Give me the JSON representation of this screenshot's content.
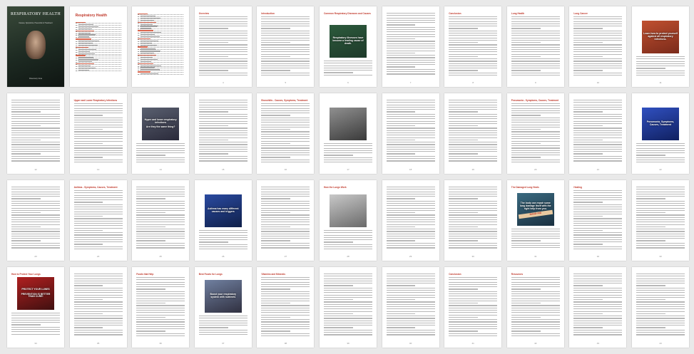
{
  "document": {
    "title": "RESPIRATORY HEALTH",
    "subtitle": "Causes, Symptoms, Prevention & Treatment",
    "author": "Rosemary Gina",
    "toc_title": "Respiratory Health"
  },
  "image_captions": {
    "p14": "Respiratory illnesses have become a leading cause of death.",
    "p18": "Learn how to protect yourself against all respiratory infections.",
    "p21": "Hyper and lower respiratory infections",
    "p21b": "Are they the same thing?",
    "p27": "Pneumonia, Symptoms, Causes, Treatment",
    "p33": "Asthma has many different causes and triggers",
    "p37": "The body can repair some lung damage itself with the right help from you.",
    "p37_label": "BAND-AID",
    "p41": "PROTECT YOUR LUNES",
    "p41b": "PREVENTION IS BETTER THAN CURE!",
    "p45": "Boost your respiratory system with nutrients"
  },
  "headings": [
    "",
    "",
    "",
    "Overview",
    "Introduction",
    "Common Respiratory Diseases and Causes",
    "",
    "Conclusion",
    "Lung Health",
    "Lung Cancer",
    "",
    "",
    "Upper and Lower Respiratory Infections",
    "",
    "",
    "Bronchitis - Causes, Symptoms, Treatment",
    "",
    "",
    "",
    "Pneumonia - Symptoms, Causes, Treatment",
    "",
    "",
    "",
    "Asthma - Symptoms, Causes, Treatment",
    "",
    "",
    "",
    "How the Lungs Work",
    "",
    "",
    "The Damaged Lung Heals",
    "Healing",
    "",
    "How to Protect Your Lungs",
    "",
    "Foods that Help",
    "Best Foods for Lungs",
    "Vitamins and Minerals",
    "",
    "",
    "Conclusion",
    "Resources"
  ],
  "page_numbers": [
    "",
    "2",
    "3",
    "4",
    "5",
    "6",
    "7",
    "8",
    "9",
    "10",
    "11",
    "12",
    "13",
    "14",
    "15",
    "16",
    "17",
    "18",
    "19",
    "20",
    "21",
    "22",
    "23",
    "24",
    "25",
    "26",
    "27",
    "28",
    "29",
    "30",
    "31",
    "32",
    "33",
    "34",
    "35",
    "36",
    "37",
    "38",
    "39",
    "40",
    "41",
    "42",
    "43",
    "44"
  ]
}
